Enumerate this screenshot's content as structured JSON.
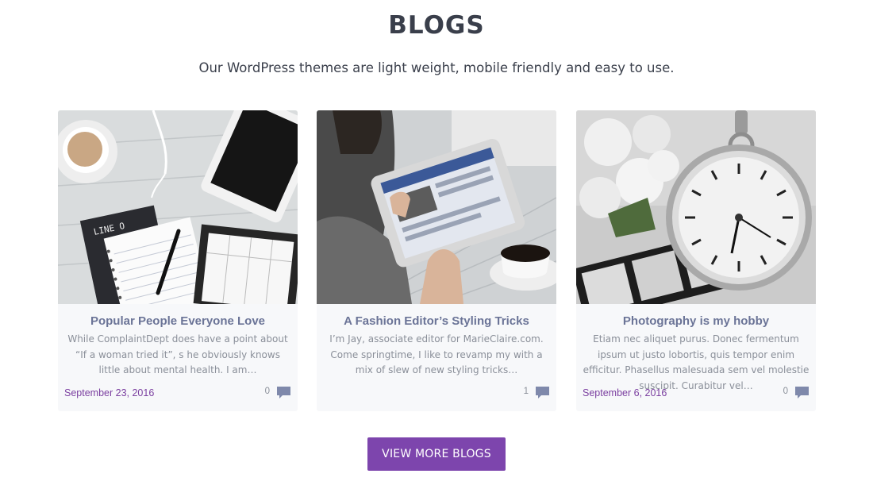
{
  "section": {
    "title": "BLOGS",
    "subtitle": "Our WordPress themes are light weight, mobile friendly and easy to use."
  },
  "posts": [
    {
      "title": "Popular People Everyone Love",
      "excerpt": "While ComplaintDept does have a point about “If a woman tried it”, s he obviously knows little about mental health. I am…",
      "date": "September 23, 2016",
      "comments": "0"
    },
    {
      "title": "A Fashion Editor’s Styling Tricks",
      "excerpt": "I’m Jay, associate editor for MarieClaire.com. Come springtime, I like to revamp my  with a mix of slew of new styling tricks…",
      "date": "",
      "comments": "1"
    },
    {
      "title": "Photography is my hobby",
      "excerpt": "Etiam nec aliquet purus. Donec fermentum ipsum ut justo lobortis, quis tempor enim efficitur. Phasellus malesuada sem vel molestie suscipit. Curabitur vel…",
      "date": "September 6, 2016",
      "comments": "0"
    }
  ],
  "photo_text": {
    "notebook_label": "LINE O"
  },
  "view_more_label": "VIEW MORE BLOGS",
  "icons": {
    "comment": "comment-icon"
  },
  "colors": {
    "accent": "#7d45ad",
    "title": "#3a3f4b",
    "card_title": "#6b7497",
    "excerpt": "#8a8f99",
    "date": "#7b3fa0",
    "card_bg": "#f7f8fa"
  }
}
